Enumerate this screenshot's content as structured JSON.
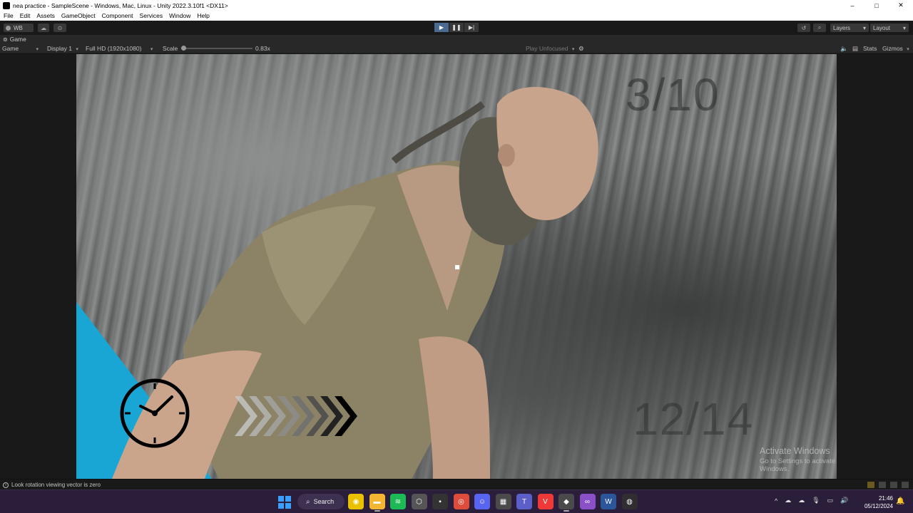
{
  "window": {
    "title": "nea practice - SampleScene - Windows, Mac, Linux - Unity 2022.3.10f1 <DX11>",
    "controls": [
      "–",
      "□",
      "✕"
    ]
  },
  "menu": [
    "File",
    "Edit",
    "Assets",
    "GameObject",
    "Component",
    "Services",
    "Window",
    "Help"
  ],
  "toolbar": {
    "account": "WB",
    "play_buttons": [
      "▶",
      "❚❚",
      "▶|"
    ],
    "layers_label": "Layers",
    "layout_label": "Layout",
    "history_icon": "↺",
    "search_icon": "⌕"
  },
  "game_tab": {
    "label": "Game"
  },
  "game_controls": {
    "mode": "Game",
    "display": "Display 1",
    "resolution": "Full HD (1920x1080)",
    "scale_label": "Scale",
    "scale_value": "0.83x",
    "play_focus": "Play Unfocused",
    "stats": "Stats",
    "gizmos": "Gizmos"
  },
  "game_view": {
    "counter_top": "3/10",
    "counter_bottom": "12/14",
    "activate_title": "Activate Windows",
    "activate_sub": "Go to Settings to activate Windows."
  },
  "status": {
    "message": "Look rotation viewing vector is zero"
  },
  "taskbar": {
    "search_label": "Search",
    "apps": [
      {
        "icon": "notes-icon",
        "glyph": "◉",
        "color": "#e9c100"
      },
      {
        "icon": "file-explorer-icon",
        "glyph": "▬",
        "color": "#f2b632"
      },
      {
        "icon": "spotify-icon",
        "glyph": "≋",
        "color": "#1db954"
      },
      {
        "icon": "unity-hub-icon",
        "glyph": "⬡",
        "color": "#555555"
      },
      {
        "icon": "terminal-icon",
        "glyph": "▪",
        "color": "#333333"
      },
      {
        "icon": "chrome-icon",
        "glyph": "◎",
        "color": "#de4c3b"
      },
      {
        "icon": "discord-icon",
        "glyph": "☺",
        "color": "#5865f2"
      },
      {
        "icon": "calculator-icon",
        "glyph": "▦",
        "color": "#4a4a4a"
      },
      {
        "icon": "teams-icon",
        "glyph": "T",
        "color": "#5b5fc7"
      },
      {
        "icon": "vivaldi-icon",
        "glyph": "V",
        "color": "#ef3939"
      },
      {
        "icon": "unity-editor-icon",
        "glyph": "◆",
        "color": "#4a4a4a"
      },
      {
        "icon": "visual-studio-icon",
        "glyph": "∞",
        "color": "#8a50c7"
      },
      {
        "icon": "word-icon",
        "glyph": "W",
        "color": "#2b579a"
      },
      {
        "icon": "obs-icon",
        "glyph": "◍",
        "color": "#302e31"
      }
    ],
    "tray": [
      "^",
      "☁",
      "☁",
      "🎙",
      "▭",
      "🔊"
    ],
    "time": "21:46",
    "date": "05/12/2024"
  }
}
